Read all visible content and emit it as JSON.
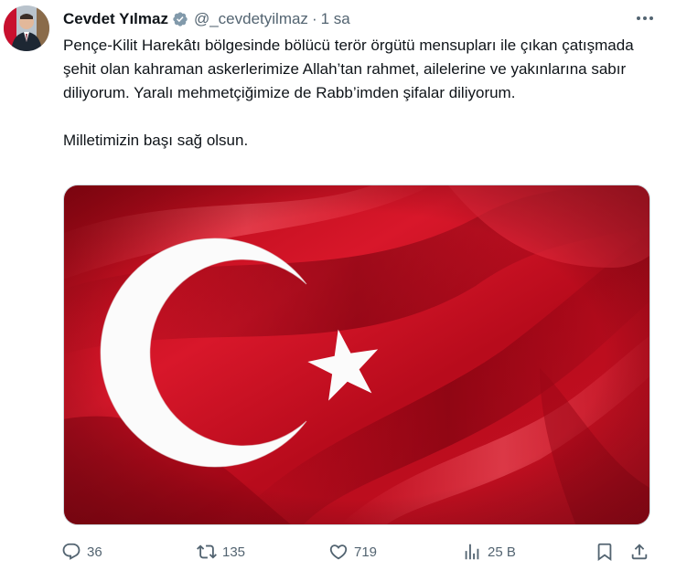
{
  "tweet": {
    "author": {
      "display_name": "Cevdet Yılmaz",
      "verified": true,
      "handle": "@_cevdetyilmaz",
      "separator": "·",
      "time": "1 sa"
    },
    "text": {
      "paragraph_1": "Pençe-Kilit Harekâtı bölgesinde bölücü terör örgütü mensupları ile çıkan çatışmada şehit olan kahraman askerlerimize Allah’tan rahmet, ailelerine ve yakınlarına sabır diliyorum. Yaralı mehmetçiğimize de Rabb’imden şifalar diliyorum.",
      "paragraph_2": "Milletimizin başı sağ olsun."
    },
    "media": {
      "description_icon": "turkish-flag-image",
      "colors": {
        "flag_red": "#d01020",
        "crescent_star": "#ffffff"
      }
    },
    "actions": {
      "replies": "36",
      "retweets": "135",
      "likes": "719",
      "views": "25 B"
    },
    "colors": {
      "text": "#0f1419",
      "secondary": "#536471",
      "verified_badge": "#829aab"
    }
  }
}
